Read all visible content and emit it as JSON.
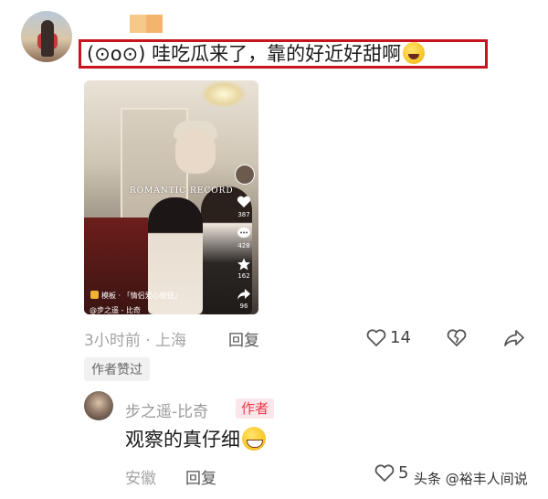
{
  "top_comment": {
    "text": "(⊙o⊙) 哇吃瓜来了，靠的好近好甜啊",
    "emoji": "laughing-emoji",
    "time_location": "3小时前 · 上海",
    "reply_label": "回复",
    "like_count": "14",
    "author_liked_label": "作者赞过",
    "highlight_color": "#c8141e"
  },
  "video": {
    "watermark": "ROMANTIC RECORD",
    "side_counts": [
      "387",
      "428",
      "162",
      "96"
    ],
    "tag": "模板 · 「情侣爱心按钮」",
    "author_line": "@步之遥 - 比奇"
  },
  "reply": {
    "username": "步之遥-比奇",
    "badge": "作者",
    "text": "观察的真仔细",
    "emoji": "grinning-sweat-emoji",
    "location": "安徽",
    "reply_label": "回复",
    "like_count": "5"
  },
  "watermark": {
    "text": "头条 @裕丰人间说"
  },
  "colors": {
    "username_placeholder": [
      "#f6c98b",
      "#f3b56e"
    ],
    "badge_bg": "#fde6ea",
    "badge_fg": "#e8394f"
  }
}
